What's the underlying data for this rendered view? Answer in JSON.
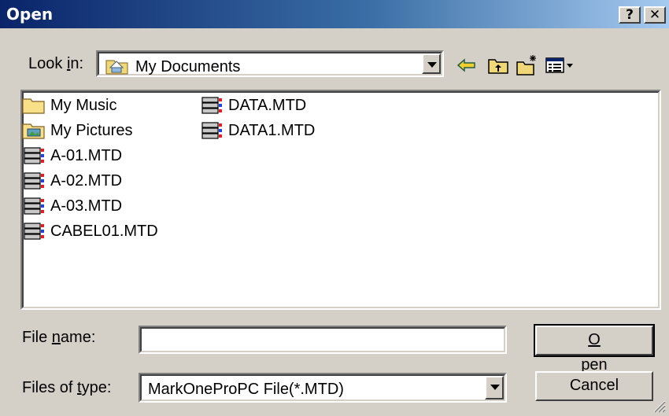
{
  "window": {
    "title": "Open",
    "help_label": "?",
    "close_label": "✕"
  },
  "lookin": {
    "label_pre": "Look ",
    "label_mn": "i",
    "label_post": "n:",
    "value": "My Documents",
    "icon": "folder-documents-icon"
  },
  "toolbar": {
    "back_icon": "back-arrow-icon",
    "up_icon": "up-folder-icon",
    "new_folder_icon": "new-folder-icon",
    "view_icon": "view-menu-icon"
  },
  "files": [
    {
      "name": "My Music",
      "type": "folder"
    },
    {
      "name": "My Pictures",
      "type": "folder-pictures"
    },
    {
      "name": "A-01.MTD",
      "type": "mtd"
    },
    {
      "name": "A-02.MTD",
      "type": "mtd"
    },
    {
      "name": "A-03.MTD",
      "type": "mtd"
    },
    {
      "name": "CABEL01.MTD",
      "type": "mtd"
    },
    {
      "name": "DATA.MTD",
      "type": "mtd"
    },
    {
      "name": "DATA1.MTD",
      "type": "mtd"
    }
  ],
  "filename": {
    "label_pre": "File ",
    "label_mn": "n",
    "label_post": "ame:",
    "value": ""
  },
  "filetype": {
    "label_pre": "Files of ",
    "label_mn": "t",
    "label_post": "ype:",
    "value": "MarkOneProPC File(*.MTD)"
  },
  "buttons": {
    "open_mn": "O",
    "open_rest": "pen",
    "cancel": "Cancel"
  }
}
